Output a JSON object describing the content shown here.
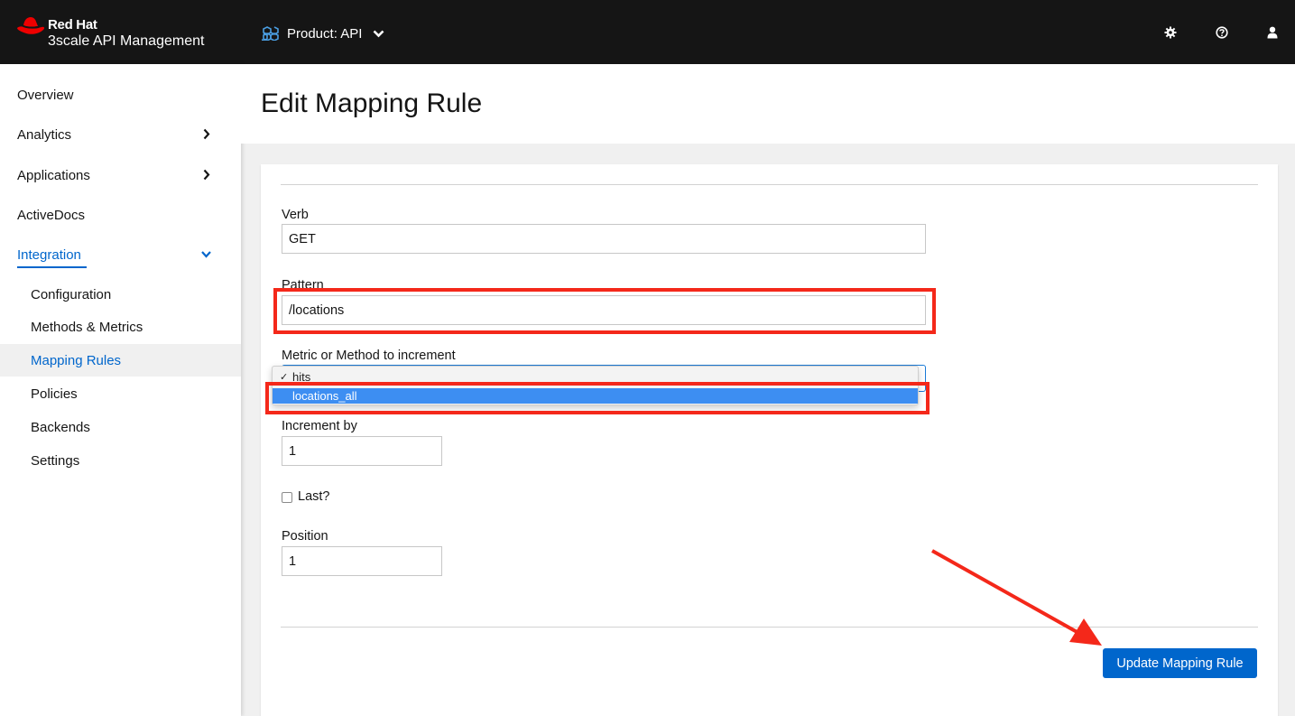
{
  "brand": {
    "line1": "Red Hat",
    "line2": "3scale API Management",
    "icon": "red-hat-logo"
  },
  "masthead": {
    "product_label": "Product: API",
    "product_icon": "product-cubes-icon",
    "icons": [
      "gear-icon",
      "help-icon",
      "user-icon"
    ]
  },
  "sidebar": {
    "items": [
      {
        "label": "Overview"
      },
      {
        "label": "Analytics",
        "icon": "chevron-right-icon"
      },
      {
        "label": "Applications",
        "icon": "chevron-right-icon"
      },
      {
        "label": "ActiveDocs"
      },
      {
        "label": "Integration",
        "icon": "chevron-down-icon",
        "active": true
      }
    ],
    "sub_items": [
      {
        "label": "Configuration"
      },
      {
        "label": "Methods & Metrics"
      },
      {
        "label": "Mapping Rules",
        "current": true
      },
      {
        "label": "Policies"
      },
      {
        "label": "Backends"
      },
      {
        "label": "Settings"
      }
    ]
  },
  "page": {
    "title": "Edit Mapping Rule"
  },
  "form": {
    "verb_label": "Verb",
    "verb_value": "GET",
    "pattern_label": "Pattern",
    "pattern_value": "/locations",
    "metric_label": "Metric or Method to increment",
    "metric_options": [
      {
        "label": "hits",
        "checked": true
      },
      {
        "label": "locations_all",
        "highlighted": true
      }
    ],
    "increment_label": "Increment by",
    "increment_value": "1",
    "last_label": "Last?",
    "last_checked": false,
    "position_label": "Position",
    "position_value": "1",
    "submit_label": "Update Mapping Rule"
  },
  "colors": {
    "accent": "#0066cc",
    "annotation": "#f4281a",
    "masthead": "#151515",
    "dropdown_highlight": "#3d8ef2"
  }
}
